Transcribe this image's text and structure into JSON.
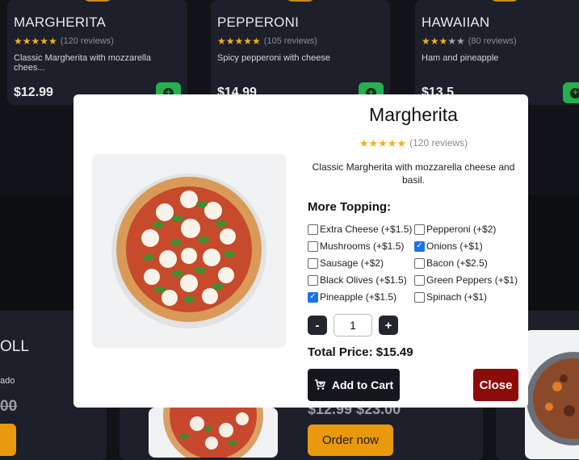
{
  "products": [
    {
      "name": "MARGHERITA",
      "stars": 5,
      "reviews": "(120 reviews)",
      "description": "Classic Margherita with mozzarella chees...",
      "price": "$12.99"
    },
    {
      "name": "PEPPERONI",
      "stars": 5,
      "reviews": "(105 reviews)",
      "description": "Spicy pepperoni with cheese",
      "price": "$14.99"
    },
    {
      "name": "HAWAIIAN",
      "stars": 3,
      "reviews": "(80 reviews)",
      "description": "Ham and pineapple",
      "price": "$13.5"
    }
  ],
  "lower_row": {
    "left_title": "OLL",
    "left_desc": "ado",
    "left_price": "00",
    "middle_price": "$12.99  $23.00",
    "order_label": "Order now"
  },
  "modal": {
    "title": "Margherita",
    "stars": 5,
    "reviews": "(120 reviews)",
    "description": "Classic Margherita with mozzarella cheese and basil.",
    "toppings_heading": "More Topping:",
    "toppings": [
      {
        "label": "Extra Cheese (+$1.5)",
        "checked": false
      },
      {
        "label": "Pepperoni (+$2)",
        "checked": false
      },
      {
        "label": "Mushrooms (+$1.5)",
        "checked": false
      },
      {
        "label": "Onions (+$1)",
        "checked": true
      },
      {
        "label": "Sausage (+$2)",
        "checked": false
      },
      {
        "label": "Bacon (+$2.5)",
        "checked": false
      },
      {
        "label": "Black Olives (+$1.5)",
        "checked": false
      },
      {
        "label": "Green Peppers (+$1)",
        "checked": false
      },
      {
        "label": "Pineapple (+$1.5)",
        "checked": true
      },
      {
        "label": "Spinach (+$1)",
        "checked": false
      }
    ],
    "minus_label": "-",
    "quantity": "1",
    "plus_label": "+",
    "total_price": "Total Price: $15.49",
    "add_to_cart_label": "Add to Cart",
    "close_label": "Close"
  },
  "colors": {
    "accent_green": "#27ae4f",
    "accent_orange": "#e8990e",
    "close_red": "#8c0b0b",
    "star_yellow": "#f2b01e"
  }
}
